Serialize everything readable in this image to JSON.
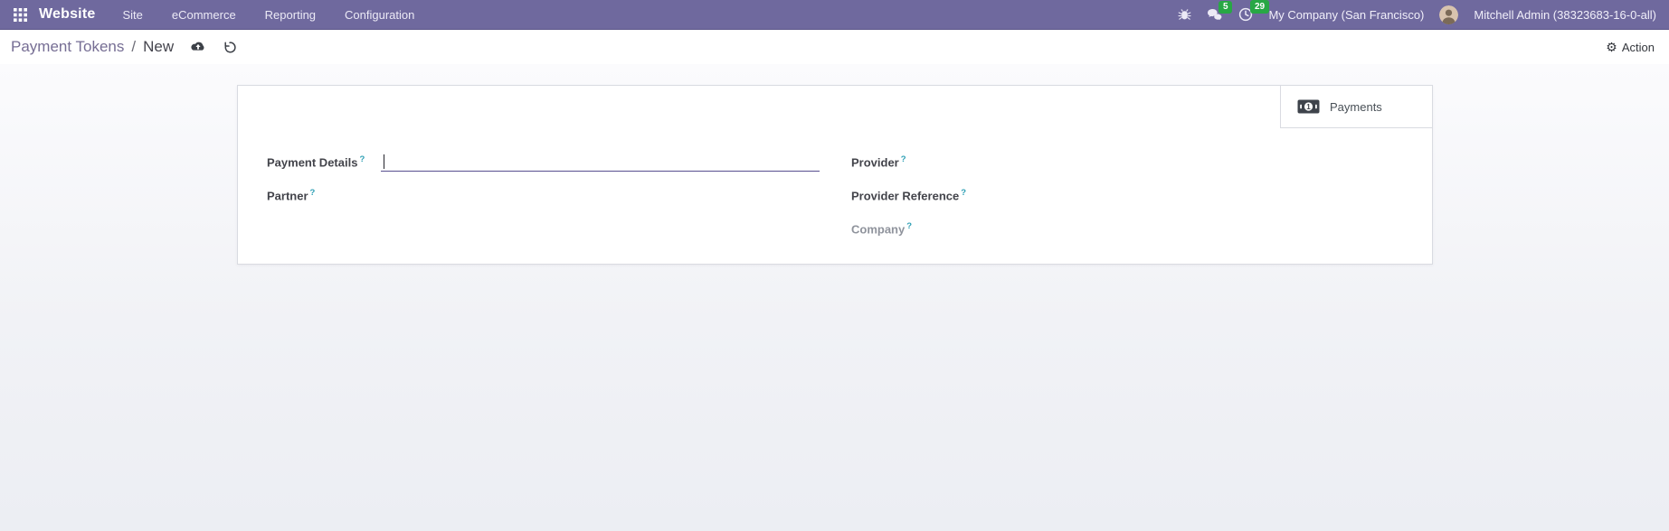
{
  "navbar": {
    "app_name": "Website",
    "menus": [
      "Site",
      "eCommerce",
      "Reporting",
      "Configuration"
    ],
    "systray": {
      "messages_badge": "5",
      "activities_badge": "29",
      "company": "My Company (San Francisco)",
      "user": "Mitchell Admin (38323683-16-0-all)"
    }
  },
  "control_panel": {
    "breadcrumb": {
      "parent": "Payment Tokens",
      "separator": "/",
      "current": "New"
    },
    "action_label": "Action"
  },
  "form": {
    "stat_button_label": "Payments",
    "fields": {
      "payment_details": {
        "label": "Payment Details",
        "help": "?",
        "value": ""
      },
      "partner": {
        "label": "Partner",
        "help": "?"
      },
      "provider": {
        "label": "Provider",
        "help": "?"
      },
      "provider_reference": {
        "label": "Provider Reference",
        "help": "?"
      },
      "company": {
        "label": "Company",
        "help": "?"
      }
    }
  },
  "colors": {
    "navbar_bg": "#6f699e",
    "badge_green": "#28a745",
    "breadcrumb_link": "#766e94",
    "focus_underline": "#574e8f",
    "help_teal": "#2d9fb4"
  }
}
